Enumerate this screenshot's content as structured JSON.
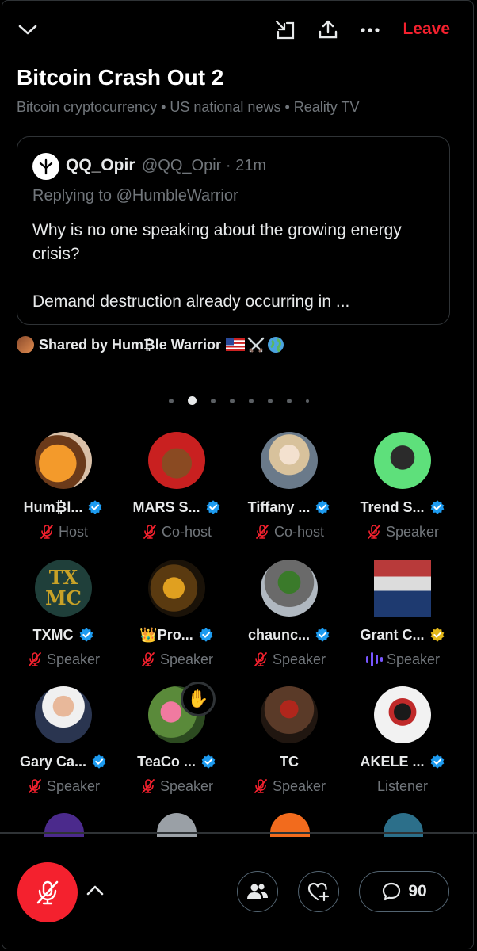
{
  "header": {
    "leave_label": "Leave",
    "icons": [
      "chevron-down-icon",
      "minimize-icon",
      "share-icon",
      "more-icon"
    ]
  },
  "space": {
    "title": "Bitcoin Crash Out 2",
    "topics": "Bitcoin cryptocurrency • US national news • Reality TV"
  },
  "pinned_post": {
    "author": "QQ_Opir",
    "handle_time": "@QQ_Opir · 21m",
    "replying_to": "Replying to @HumbleWarrior",
    "text_line1": "Why is no one speaking about the growing energy crisis?",
    "text_line2": "Demand destruction already occurring in ..."
  },
  "shared_by": "Shared by Hum₿le Warrior",
  "pagination": {
    "count": 8,
    "active_index": 1
  },
  "participants": [
    {
      "name": "Hum₿l...",
      "role": "Host",
      "verified": "blue",
      "muted": true
    },
    {
      "name": "MARS S...",
      "role": "Co-host",
      "verified": "blue",
      "muted": true
    },
    {
      "name": "Tiffany ...",
      "role": "Co-host",
      "verified": "blue",
      "muted": true
    },
    {
      "name": "Trend S...",
      "role": "Speaker",
      "verified": "blue",
      "muted": true
    },
    {
      "name": "TXMC",
      "role": "Speaker",
      "verified": "blue",
      "muted": true
    },
    {
      "name": "👑Pro...",
      "role": "Speaker",
      "verified": "blue",
      "muted": true
    },
    {
      "name": "chaunc...",
      "role": "Speaker",
      "verified": "blue",
      "muted": true
    },
    {
      "name": "Grant C...",
      "role": "Speaker",
      "verified": "gold",
      "muted": false,
      "speaking": true
    },
    {
      "name": "Gary Ca...",
      "role": "Speaker",
      "verified": "blue",
      "muted": true
    },
    {
      "name": "TeaCo ...",
      "role": "Speaker",
      "verified": "blue",
      "muted": true,
      "hand_raised": true
    },
    {
      "name": "TC",
      "role": "Speaker",
      "verified": "none",
      "muted": true
    },
    {
      "name": "AKELE ...",
      "role": "Listener",
      "verified": "blue",
      "muted": false
    }
  ],
  "bottom_bar": {
    "comment_count": "90",
    "icons": [
      "mic-muted-icon",
      "chevron-up-icon",
      "people-icon",
      "heart-plus-icon",
      "comment-icon"
    ]
  },
  "colors": {
    "accent_red": "#f4212e",
    "verified_blue": "#1d9bf0",
    "verified_gold": "#e2b719",
    "muted_text": "#71767b"
  }
}
